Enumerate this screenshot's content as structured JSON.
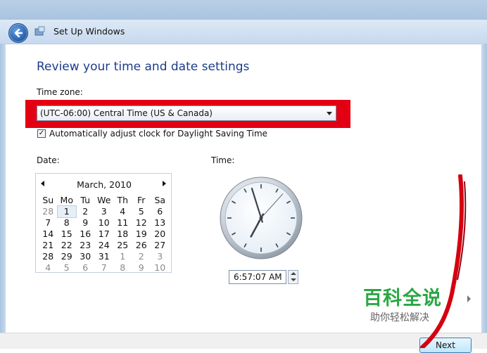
{
  "window": {
    "title": "Set Up Windows"
  },
  "page": {
    "heading": "Review your time and date settings"
  },
  "timezone": {
    "label": "Time zone:",
    "value": "(UTC-06:00) Central Time (US & Canada)"
  },
  "dst": {
    "label": "Automatically adjust clock for Daylight Saving Time",
    "checked": true
  },
  "date": {
    "label": "Date:",
    "month": "March, 2010",
    "weekdays": [
      "Su",
      "Mo",
      "Tu",
      "We",
      "Th",
      "Fr",
      "Sa"
    ],
    "weeks": [
      [
        "28",
        "1",
        "2",
        "3",
        "4",
        "5",
        "6"
      ],
      [
        "7",
        "8",
        "9",
        "10",
        "11",
        "12",
        "13"
      ],
      [
        "14",
        "15",
        "16",
        "17",
        "18",
        "19",
        "20"
      ],
      [
        "21",
        "22",
        "23",
        "24",
        "25",
        "26",
        "27"
      ],
      [
        "28",
        "29",
        "30",
        "31",
        "1",
        "2",
        "3"
      ],
      [
        "4",
        "5",
        "6",
        "7",
        "8",
        "9",
        "10"
      ]
    ],
    "selected_day": "1"
  },
  "time": {
    "label": "Time:",
    "value": "6:57:07 AM",
    "hour": 6,
    "minute": 57,
    "second": 7
  },
  "footer": {
    "next_label": "Next"
  },
  "watermark": {
    "title": "百科全说",
    "subtitle": "助你轻松解决"
  },
  "colors": {
    "highlight_red": "#e30013",
    "heading_blue": "#1c3c8a",
    "watermark_green": "#2aa744"
  }
}
